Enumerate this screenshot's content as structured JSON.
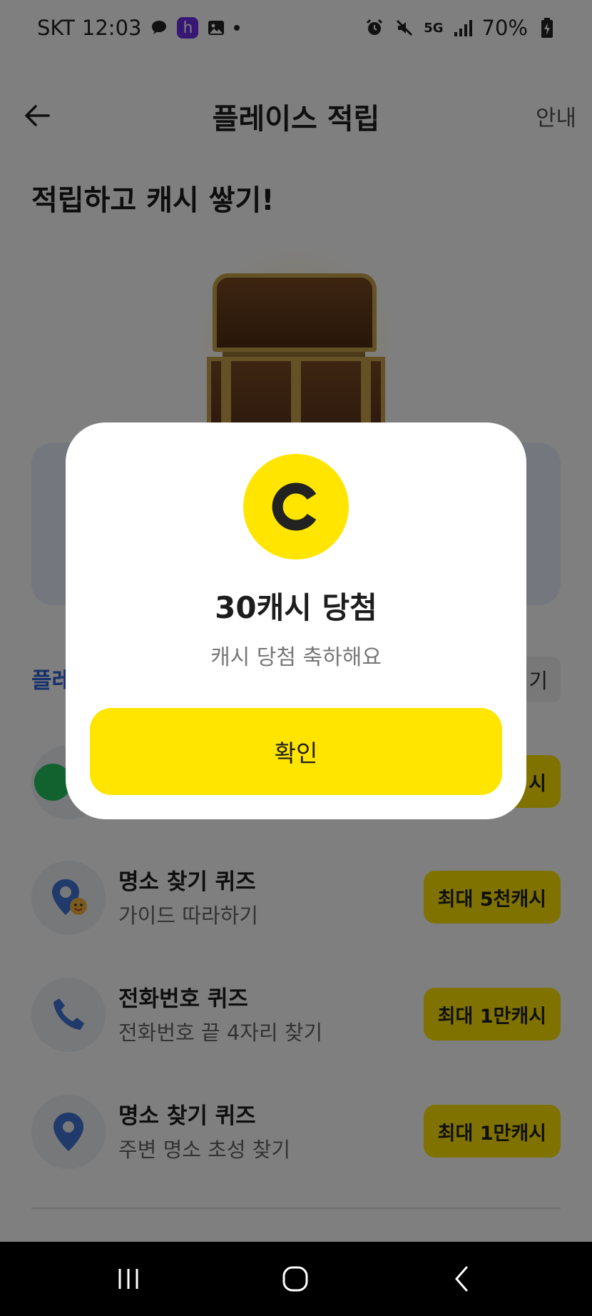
{
  "status_bar": {
    "carrier": "SKT",
    "time": "12:03",
    "network": "5G",
    "battery": "70%"
  },
  "app_bar": {
    "title": "플레이스 적립",
    "info_label": "안내"
  },
  "headline": "적립하고 캐시 쌓기!",
  "section": {
    "title_partial": "플레",
    "more_partial": "기"
  },
  "missions": [
    {
      "title": "명소 찾기 퀴즈",
      "subtitle": "가이드 따라하기",
      "reward": "최대 5천캐시",
      "icon": "map-pin-smile-icon"
    },
    {
      "title": "전화번호 퀴즈",
      "subtitle": "전화번호 끝 4자리 찾기",
      "reward": "최대 1만캐시",
      "icon": "phone-icon"
    },
    {
      "title": "명소 찾기 퀴즈",
      "subtitle": "주변 명소 초성 찾기",
      "reward": "최대 1만캐시",
      "icon": "map-pin-icon"
    }
  ],
  "hidden_reward_partial": "시",
  "modal": {
    "coin_letter": "C",
    "title": "30캐시 당첨",
    "subtitle": "캐시 당첨 축하해요",
    "confirm_label": "확인"
  },
  "colors": {
    "accent_yellow": "#ffe500",
    "section_blue": "#2f63d4",
    "icon_blue": "#3f74d6"
  }
}
